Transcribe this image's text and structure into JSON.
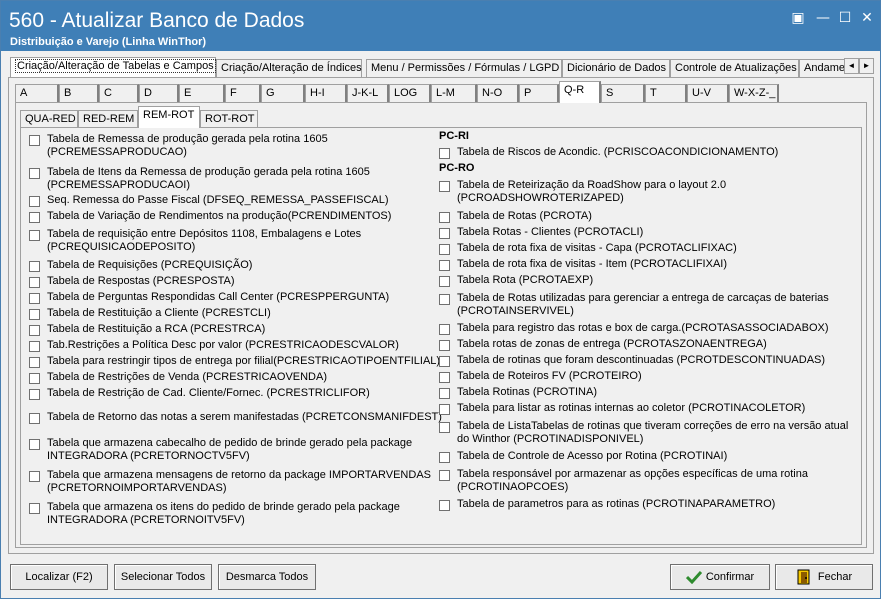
{
  "window": {
    "title": "560 - Atualizar Banco de Dados",
    "subtitle": "Distribuição e Varejo (Linha WinThor)",
    "controls": {
      "restore_glyph": "▣",
      "minimize_glyph": "—",
      "maximize_glyph": "☐",
      "close_glyph": "✕"
    }
  },
  "top_tabs": [
    {
      "label": "Criação/Alteração de Tabelas e Campos",
      "active": true
    },
    {
      "label": "Criação/Alteração de Índices"
    },
    {
      "label": "Menu / Permissões / Fórmulas / LGPD"
    },
    {
      "label": "Dicionário de Dados"
    },
    {
      "label": "Controle de Atualizações"
    },
    {
      "label": "Andame"
    }
  ],
  "scroll_arrows": {
    "left": "◄",
    "right": "►"
  },
  "letter_tabs": [
    "A",
    "B",
    "C",
    "D",
    "E",
    "F",
    "G",
    "H-I",
    "J-K-L",
    "LOG",
    "L-M",
    "N-O",
    "P",
    "Q-R",
    "S",
    "T",
    "U-V",
    "W-X-Z-_"
  ],
  "active_letter_tab": "Q-R",
  "sub_tabs": [
    "QUA-RED",
    "RED-REM",
    "REM-ROT",
    "ROT-ROT"
  ],
  "active_sub_tab": "REM-ROT",
  "left_items": [
    "Tabela de Remessa de produção gerada pela rotina 1605\n(PCREMESSAPRODUCAO)",
    "Tabela de Itens da Remessa de produção gerada pela rotina 1605\n(PCREMESSAPRODUCAOI)",
    "Seq. Remessa do Passe Fiscal (DFSEQ_REMESSA_PASSEFISCAL)",
    "Tabela de Variação de Rendimentos na produção(PCRENDIMENTOS)",
    "Tabela de requisição entre Depósitos 1108, Embalagens e Lotes\n(PCREQUISICAODEPOSITO)",
    "Tabela de Requisições (PCREQUISIÇÃO)",
    "Tabela de Respostas (PCRESPOSTA)",
    "Tabela de Perguntas Respondidas Call Center (PCRESPPERGUNTA)",
    "Tabela de Restituição a Cliente (PCRESTCLI)",
    "Tabela de Restituição a RCA (PCRESTRCA)",
    "Tab.Restrições a Política Desc por valor (PCRESTRICAODESCVALOR)",
    "Tabela para restringir tipos de entrega por filial(PCRESTRICAOTIPOENTFILIAL)",
    "Tabela de Restrições de Venda (PCRESTRICAOVENDA)",
    "Tabela de Restrição de Cad. Cliente/Fornec. (PCRESTRICLIFOR)",
    "Tabela de Retorno das notas a serem manifestadas (PCRETCONSMANIFDEST)",
    "Tabela que armazena cabecalho de pedido de brinde gerado pela package\nINTEGRADORA (PCRETORNOCTV5FV)",
    "Tabela que armazena mensagens de retorno da  package IMPORTARVENDAS\n(PCRETORNOIMPORTARVENDAS)",
    "Tabela que armazena os itens do pedido de brinde gerado pela package\nINTEGRADORA (PCRETORNOITV5FV)"
  ],
  "right_groups": [
    {
      "title": "PC-RI",
      "items": [
        "Tabela de Riscos de Acondic. (PCRISCOACONDICIONAMENTO)"
      ]
    },
    {
      "title": "PC-RO",
      "items": [
        "Tabela de Reteirização da RoadShow para o layout 2.0\n(PCROADSHOWROTERIZAPED)",
        "Tabela de Rotas (PCROTA)",
        "Tabela Rotas - Clientes  (PCROTACLI)",
        "Tabela de rota fixa de visitas - Capa (PCROTACLIFIXAC)",
        "Tabela de rota fixa de visitas - Item (PCROTACLIFIXAI)",
        "Tabela Rota (PCROTAEXP)",
        "Tabela de Rotas utilizadas para gerenciar a entrega de carcaças de baterias\n(PCROTAINSERVIVEL)",
        "Tabela para registro das rotas e box de carga.(PCROTASASSOCIADABOX)",
        "Tabela rotas de zonas de entrega (PCROTASZONAENTREGA)",
        "Tabela de rotinas que foram descontinuadas (PCROTDESCONTINUADAS)",
        "Tabela de Roteiros FV (PCROTEIRO)",
        "Tabela Rotinas (PCROTINA)",
        "Tabela para listar as rotinas internas ao coletor (PCROTINACOLETOR)",
        "Tabela de ListaTabelas de rotinas que tiveram correções de erro na versão atual\ndo Winthor (PCROTINADISPONIVEL)",
        "Tabela de Controle de Acesso por Rotina (PCROTINAI)",
        "Tabela responsável por armazenar as opções específicas de uma rotina\n(PCROTINAOPCOES)",
        "Tabela de parametros para as rotinas (PCROTINAPARAMETRO)"
      ]
    }
  ],
  "buttons": {
    "localizar": "Localizar (F2)",
    "selecionar_todos": "Selecionar Todos",
    "desmarca_todos": "Desmarca Todos",
    "confirmar": "Confirmar",
    "fechar": "Fechar"
  },
  "colors": {
    "titlebar": "#3f7fb7",
    "confirm_icon": "#2e8b2e",
    "exit_icon": "#e0b000"
  }
}
